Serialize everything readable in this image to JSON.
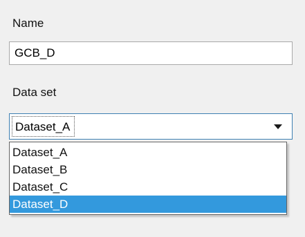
{
  "form": {
    "name_label": "Name",
    "name_value": "GCB_D",
    "dataset_label": "Data set",
    "dataset_selected": "Dataset_A",
    "dataset_options": [
      "Dataset_A",
      "Dataset_B",
      "Dataset_C",
      "Dataset_D"
    ],
    "highlighted_option": "Dataset_D"
  },
  "colors": {
    "highlight": "#3399dd",
    "focus_border": "#3c7fb1"
  },
  "icons": {
    "dropdown": "chevron-down-icon"
  }
}
